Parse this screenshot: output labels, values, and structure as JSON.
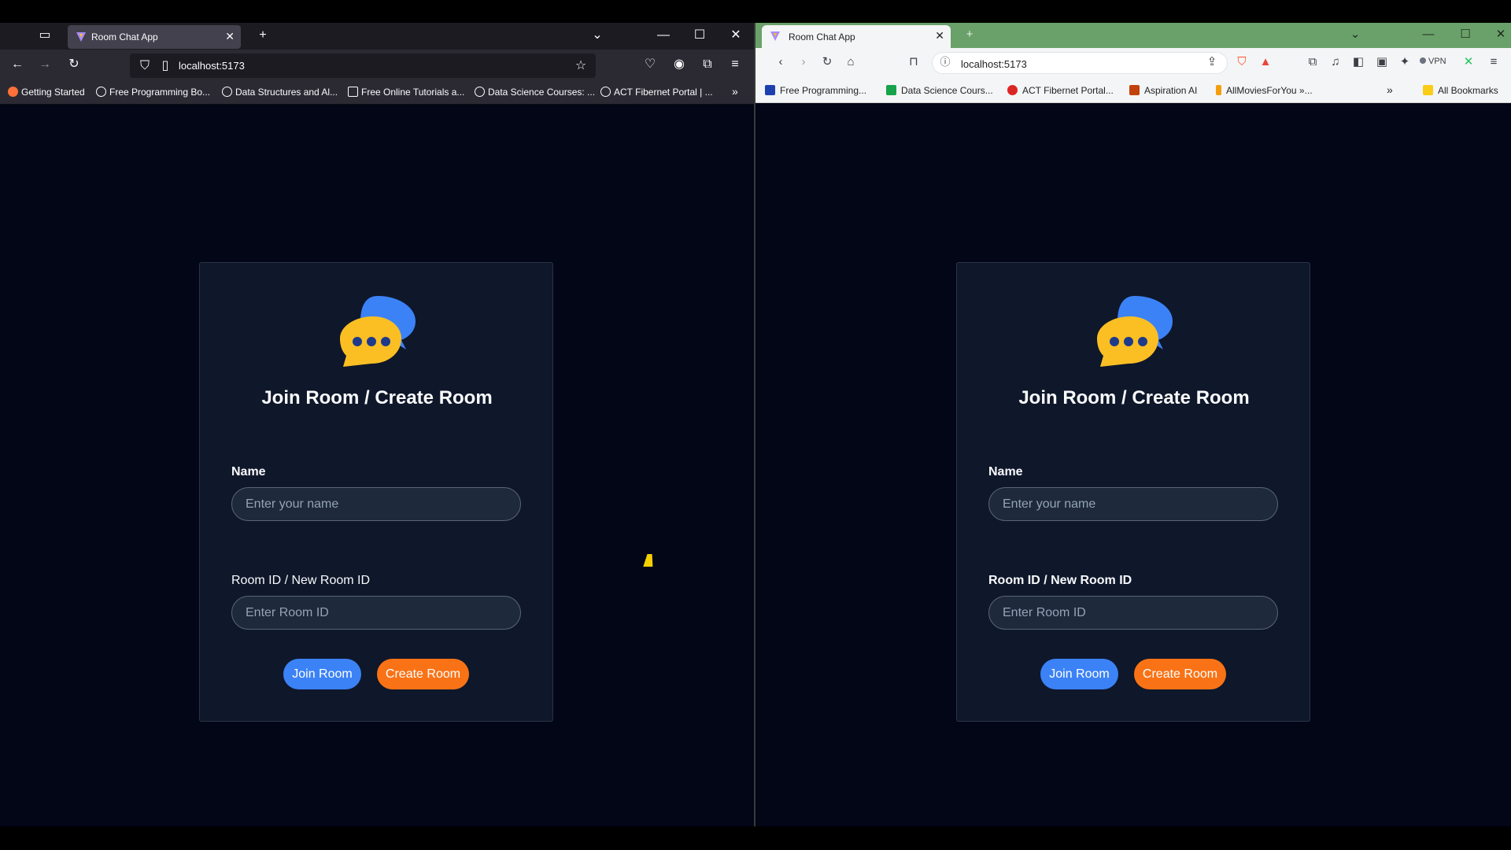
{
  "left_browser": {
    "tab_title": "Room Chat App",
    "url": "localhost:5173",
    "bookmarks": [
      "Getting Started",
      "Free Programming Bo...",
      "Data Structures and Al...",
      "Free Online Tutorials a...",
      "Data Science Courses: ...",
      "ACT Fibernet Portal | ..."
    ]
  },
  "right_browser": {
    "tab_title": "Room Chat App",
    "url": "localhost:5173",
    "vpn_label": "VPN",
    "bookmarks": [
      "Free Programming...",
      "Data Science Cours...",
      "ACT Fibernet Portal...",
      "Aspiration AI",
      "AllMoviesForYou »..."
    ],
    "all_bookmarks": "All Bookmarks"
  },
  "app": {
    "title": "Join Room / Create Room",
    "name_label": "Name",
    "name_placeholder": "Enter your name",
    "room_label": "Room ID / New Room ID",
    "room_placeholder": "Enter Room ID",
    "join_button": "Join Room",
    "create_button": "Create Room"
  },
  "colors": {
    "background": "#020617",
    "card": "#0f172a",
    "join": "#3b82f6",
    "create": "#f97316",
    "logo_yellow": "#fbbf24",
    "logo_blue": "#3b82f6"
  }
}
